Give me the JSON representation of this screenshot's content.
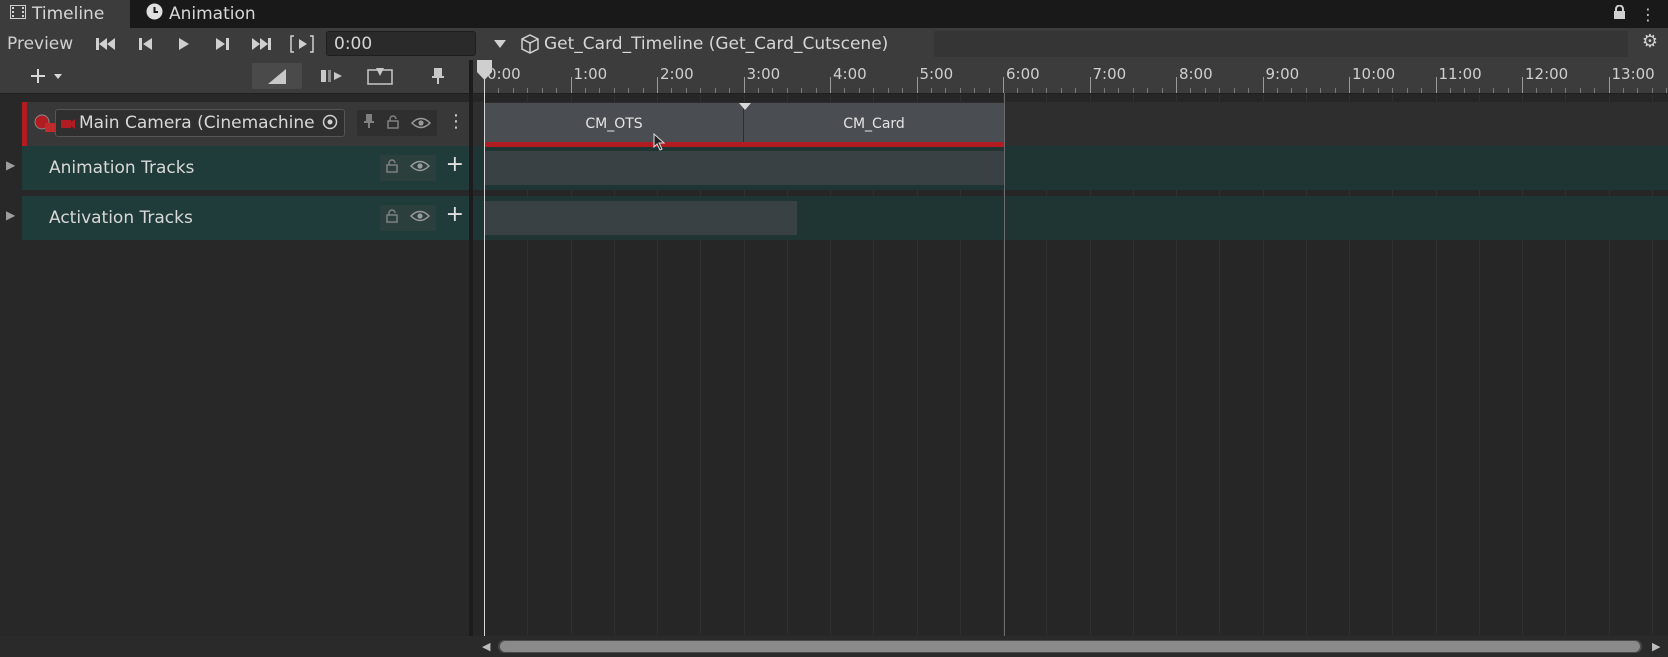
{
  "tabs": [
    {
      "label": "Timeline",
      "icon": "film-strip-icon",
      "active": true
    },
    {
      "label": "Animation",
      "icon": "clock-icon",
      "active": false
    }
  ],
  "toolbar": {
    "preview_label": "Preview",
    "time_value": "0:00",
    "breadcrumb": "Get_Card_Timeline (Get_Card_Cutscene)",
    "buttons": [
      "go-to-start",
      "previous-frame",
      "play",
      "next-frame",
      "go-to-end",
      "play-range"
    ]
  },
  "ruler": {
    "labels": [
      "0:00",
      "1:00",
      "2:00",
      "3:00",
      "4:00",
      "5:00",
      "6:00",
      "7:00",
      "8:00",
      "9:00",
      "10:00",
      "11:00",
      "12:00",
      "13:00"
    ]
  },
  "tracks": [
    {
      "label": "Main Camera (Cinemachinе",
      "type": "cinemachine"
    },
    {
      "label": "Animation Tracks",
      "type": "group"
    },
    {
      "label": "Activation Tracks",
      "type": "group"
    }
  ],
  "clips": [
    {
      "label": "CM_OTS"
    },
    {
      "label": "CM_Card"
    }
  ],
  "colors": {
    "accent_red": "#b01c22",
    "group_teal": "#203c3a",
    "clip_gray": "#4a4e52"
  }
}
